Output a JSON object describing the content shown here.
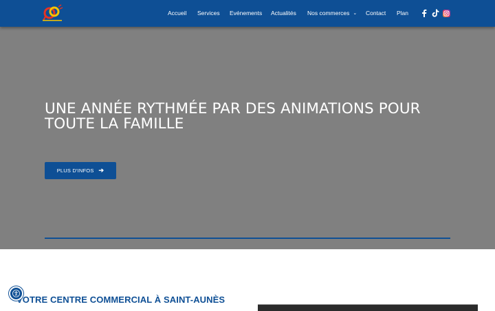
{
  "header": {
    "logo_name": "logo",
    "nav": [
      {
        "label": "Accueil"
      },
      {
        "label": "Services"
      },
      {
        "label": "Evénements"
      },
      {
        "label": "Actualités"
      },
      {
        "label": "Nos commerces",
        "has_dropdown": true
      },
      {
        "label": "Contact"
      },
      {
        "label": "Plan"
      }
    ],
    "social": [
      "facebook-icon",
      "tiktok-icon",
      "instagram-icon"
    ]
  },
  "hero": {
    "title": " UNE ANNÉE RYTHMÉE PAR DES ANIMATIONS POUR TOUTE LA FAMILLE ",
    "cta_label": "PLUS D'INFOS"
  },
  "section": {
    "title": "VOTRE CENTRE COMMERCIAL À SAINT-AUNÈS"
  },
  "colors": {
    "primary": "#0e4f95",
    "hero_bg": "#808080",
    "text_light": "#ffffff"
  }
}
